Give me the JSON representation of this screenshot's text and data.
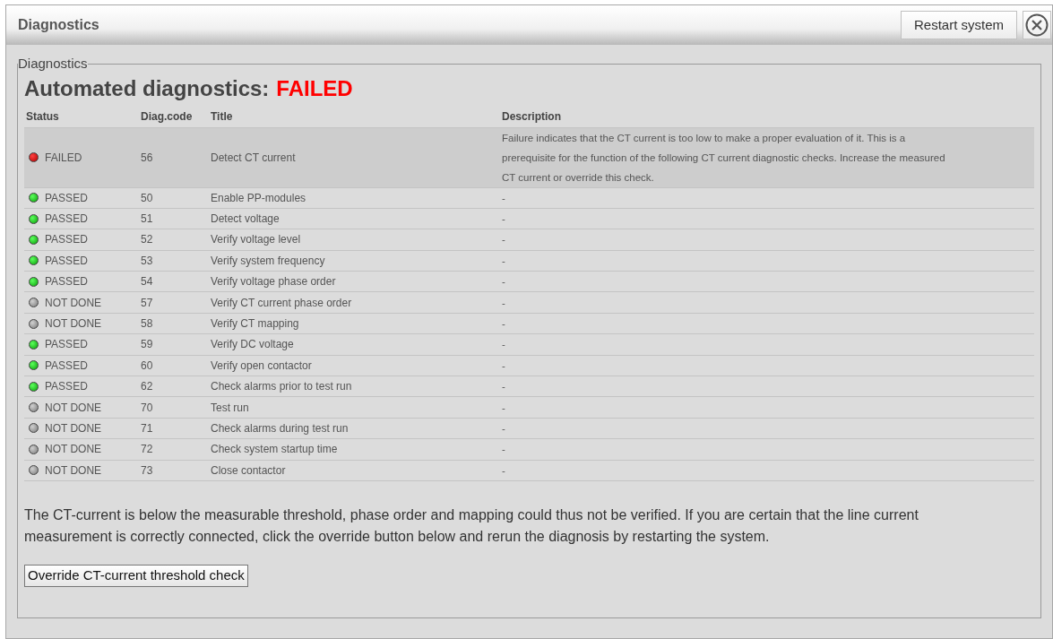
{
  "window": {
    "title": "Diagnostics",
    "restart_button": "Restart system"
  },
  "section": {
    "legend": "Diagnostics",
    "heading": "Automated diagnostics:",
    "result": "FAILED"
  },
  "table": {
    "columns": [
      "Status",
      "Diag.code",
      "Title",
      "Description"
    ],
    "rows": [
      {
        "kind": "failed",
        "status": "FAILED",
        "code": "56",
        "title": "Detect CT current",
        "description": "Failure indicates that the CT current is too low to make a proper evaluation of it. This is a prerequisite for the function of the following CT current diagnostic checks. Increase the measured CT current or override this check."
      },
      {
        "kind": "passed",
        "status": "PASSED",
        "code": "50",
        "title": "Enable PP-modules",
        "description": "-"
      },
      {
        "kind": "passed",
        "status": "PASSED",
        "code": "51",
        "title": "Detect voltage",
        "description": "-"
      },
      {
        "kind": "passed",
        "status": "PASSED",
        "code": "52",
        "title": "Verify voltage level",
        "description": "-"
      },
      {
        "kind": "passed",
        "status": "PASSED",
        "code": "53",
        "title": "Verify system frequency",
        "description": "-"
      },
      {
        "kind": "passed",
        "status": "PASSED",
        "code": "54",
        "title": "Verify voltage phase order",
        "description": "-"
      },
      {
        "kind": "not_done",
        "status": "NOT DONE",
        "code": "57",
        "title": "Verify CT current phase order",
        "description": "-"
      },
      {
        "kind": "not_done",
        "status": "NOT DONE",
        "code": "58",
        "title": "Verify CT mapping",
        "description": "-"
      },
      {
        "kind": "passed",
        "status": "PASSED",
        "code": "59",
        "title": "Verify DC voltage",
        "description": "-"
      },
      {
        "kind": "passed",
        "status": "PASSED",
        "code": "60",
        "title": "Verify open contactor",
        "description": "-"
      },
      {
        "kind": "passed",
        "status": "PASSED",
        "code": "62",
        "title": "Check alarms prior to test run",
        "description": "-"
      },
      {
        "kind": "not_done",
        "status": "NOT DONE",
        "code": "70",
        "title": "Test run",
        "description": "-"
      },
      {
        "kind": "not_done",
        "status": "NOT DONE",
        "code": "71",
        "title": "Check alarms during test run",
        "description": "-"
      },
      {
        "kind": "not_done",
        "status": "NOT DONE",
        "code": "72",
        "title": "Check system startup time",
        "description": "-"
      },
      {
        "kind": "not_done",
        "status": "NOT DONE",
        "code": "73",
        "title": "Close contactor",
        "description": "-"
      }
    ]
  },
  "message": "The CT-current is below the measurable threshold, phase order and mapping could thus not be verified. If you are certain that the line current measurement is correctly connected, click the override button below and rerun the diagnosis by restarting the system.",
  "override_button": "Override CT-current threshold check"
}
